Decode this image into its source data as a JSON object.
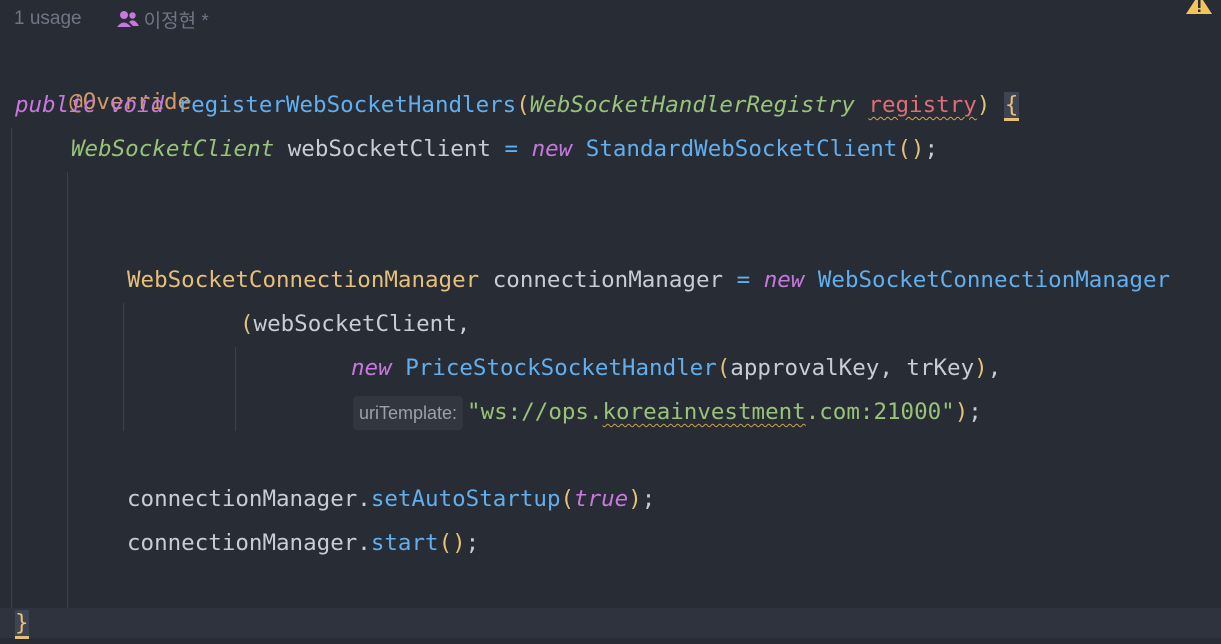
{
  "inlay_hint": {
    "usages": "1 usage",
    "author": "이정현 *"
  },
  "code": {
    "annotation": "@Override",
    "kw_public": "public",
    "kw_void": "void",
    "method_name": "registerWebSocketHandlers",
    "param_type": "WebSocketHandlerRegistry",
    "param_name": "registry",
    "open_brace": "{",
    "client_type": "WebSocketClient",
    "client_var": "webSocketClient",
    "kw_new": "new",
    "client_impl": "StandardWebSocketClient",
    "manager_type": "WebSocketConnectionManager",
    "manager_var": "connectionManager",
    "manager_impl": "WebSocketConnectionManager",
    "arg_client": "webSocketClient",
    "handler_class": "PriceStockSocketHandler",
    "arg_key1": "approvalKey",
    "arg_key2": "trKey",
    "param_hint": "uriTemplate:",
    "url_prefix": "\"ws://ops.",
    "url_host": "koreainvestment",
    "url_suffix": ".com:21000\"",
    "set_auto_startup": "setAutoStartup",
    "kw_true": "true",
    "start": "start",
    "close_brace": "}"
  },
  "colors": {
    "background": "#282c34",
    "keyword": "#c678dd",
    "function": "#61afef",
    "string": "#98c379",
    "class": "#e5c07b"
  },
  "icons": [
    "people-icon",
    "warning-icon"
  ]
}
